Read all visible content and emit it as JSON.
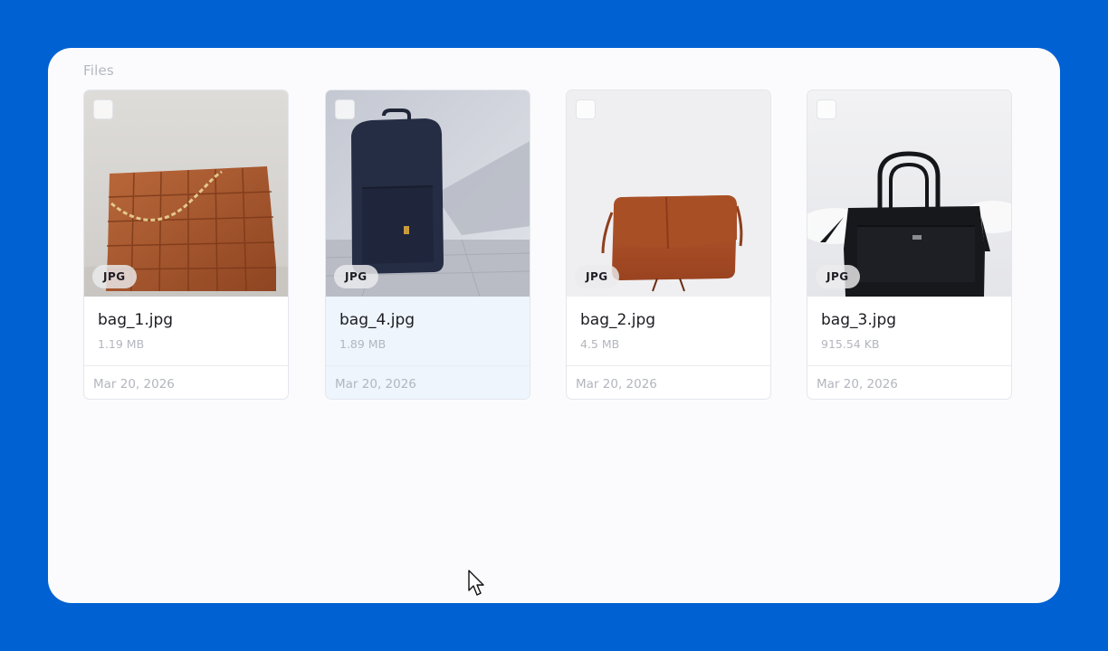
{
  "section": {
    "title": "Files"
  },
  "files": [
    {
      "name": "bag_1.jpg",
      "size": "1.19 MB",
      "date": "Mar 20, 2026",
      "type": "JPG",
      "selected": false
    },
    {
      "name": "bag_4.jpg",
      "size": "1.89 MB",
      "date": "Mar 20, 2026",
      "type": "JPG",
      "selected": true
    },
    {
      "name": "bag_2.jpg",
      "size": "4.5 MB",
      "date": "Mar 20, 2026",
      "type": "JPG",
      "selected": false
    },
    {
      "name": "bag_3.jpg",
      "size": "915.54 KB",
      "date": "Mar 20, 2026",
      "type": "JPG",
      "selected": false
    }
  ],
  "colors": {
    "background": "#0061d3",
    "panel": "#fbfbfd",
    "selected_card": "#eef5fd",
    "muted_text": "#b3b6bd"
  },
  "icons": [
    "mouse-cursor-icon"
  ]
}
